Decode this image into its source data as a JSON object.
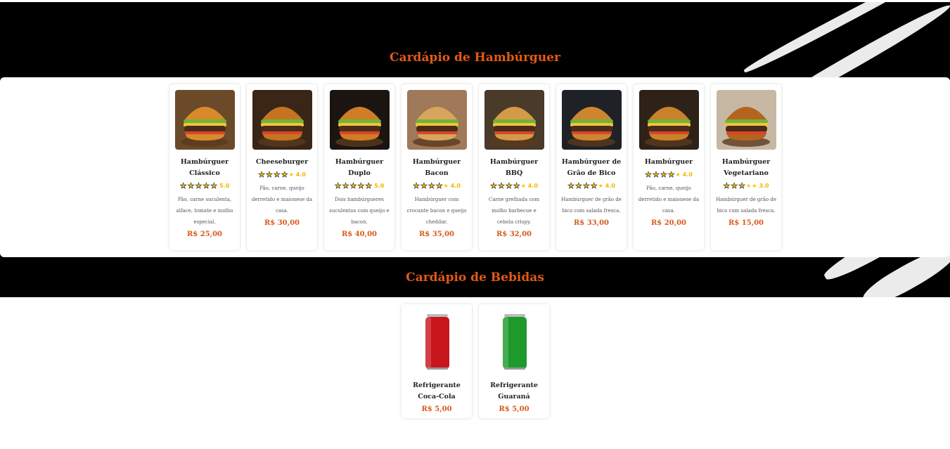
{
  "sections": {
    "burgers_title": "Cardápio de Hambúrguer",
    "drinks_title": "Cardápio de Bebidas"
  },
  "burgers": [
    {
      "name": "Hambúrguer Clássico",
      "rating": 5,
      "score": "5.0",
      "description": "Pão, carne suculenta, alface, tomate e molho especial.",
      "price": "R$ 25,00",
      "image": "burger-classic-photo"
    },
    {
      "name": "Cheeseburger",
      "rating": 4,
      "score": "4.0",
      "description": "Pão, carne, queijo derretido e maionese da casa.",
      "price": "R$ 30,00",
      "image": "cheeseburger-photo"
    },
    {
      "name": "Hambúrguer Duplo",
      "rating": 5,
      "score": "5.0",
      "description": "Dois hambúrgueres suculentos com queijo e bacon.",
      "price": "R$ 40,00",
      "image": "double-burger-photo"
    },
    {
      "name": "Hambúrguer Bacon",
      "rating": 4,
      "score": "4.0",
      "description": "Hambúrguer com crocante bacon e queijo cheddar.",
      "price": "R$ 35,00",
      "image": "bacon-burger-photo"
    },
    {
      "name": "Hambúrguer BBQ",
      "rating": 4,
      "score": "4.0",
      "description": "Carne grelhada com molho barbecue e cebola crispy.",
      "price": "R$ 32,00",
      "image": "bbq-burger-photo"
    },
    {
      "name": "Hambúrguer de Grão de Bico",
      "rating": 4,
      "score": "4.0",
      "description": "Hambúrguer de grão de bico com salada fresca.",
      "price": "R$ 33,00",
      "image": "chickpea-burger-photo"
    },
    {
      "name": "Hambúrguer",
      "rating": 4,
      "score": "4.0",
      "description": "Pão, carne, queijo derretido e maionese da casa.",
      "price": "R$ 20,00",
      "image": "burger-photo"
    },
    {
      "name": "Hambúrguer Vegetariano",
      "rating": 3,
      "score": "3.0",
      "description": "Hambúrguer de grão de bico com salada fresca.",
      "price": "R$ 15,00",
      "image": "veggie-burger-photo"
    }
  ],
  "drinks": [
    {
      "name": "Refrigerante Coca-Cola",
      "price": "R$ 5,00",
      "image": "coca-cola-can",
      "can_color": "#c8161d"
    },
    {
      "name": "Refrigerante Guaraná",
      "price": "R$ 5,00",
      "image": "guarana-can",
      "can_color": "#1e9a2c"
    }
  ],
  "colors": {
    "accent": "#e25a16",
    "price": "#d8581a",
    "star": "#f5c400",
    "background": "#000000",
    "panel": "#ffffff"
  }
}
